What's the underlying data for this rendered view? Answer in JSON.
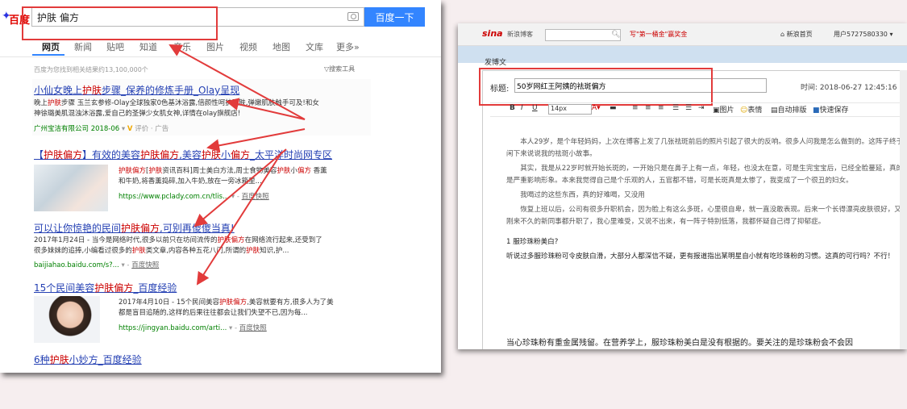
{
  "baidu": {
    "logo_text": "百度",
    "search_value": "护肤 偏方",
    "search_button": "百度一下",
    "tabs": [
      "网页",
      "新闻",
      "贴吧",
      "知道",
      "音乐",
      "图片",
      "视频",
      "地图",
      "文库",
      "更多»"
    ],
    "result_count": "百度为您找到相关结果约13,100,000个",
    "search_tools": "搜索工具",
    "results": [
      {
        "title": "小仙女晚上护肤步骤_保养的修炼手册_Olay呈现",
        "desc_line1": "晚上护肤步骤 玉兰玄参修-Olay全球独家0色基沐浴露,倍颜性呵护肌肤,弹嫩肌肤触手可及!和女",
        "desc_line2": "神徐璐美肌混浊沐浴露,爱自己的圣弹少女肌女神,详情在olay旗舰店!",
        "url": "广州宝洁有限公司  2018-06",
        "extra": "评价 · 广告"
      },
      {
        "title": "【护肤偏方】有效的美容护肤偏方,美容护肤小偏方_太平洋时尚网专区",
        "desc_line1": "护肤偏方[护肤资讯百科]周士美白方法,周士食物美容护肤小偏方 香薰",
        "desc_line2": "和牛奶,将香薰捣碎,加入牛奶,放在一旁冰箱里...",
        "url": "https://www.pclady.com.cn/tlis...",
        "extra": "百度快照"
      },
      {
        "title": "可以让你惊艳的民间护肤偏方,可别再傻傻当真!",
        "desc_line1": "2017年1月24日 - 当今是网络时代,很多以前只在坊间流传的护肤偏方在网络流行起来,还受到了",
        "desc_line2": "很多妹妹的追捧,小编看过很多的护肤类文章,内容各种五花八门,所谓的护肤知识,护...",
        "url": "baijiahao.baidu.com/s?...",
        "extra": "百度快照"
      },
      {
        "title": "15个民间美容护肤偏方_百度经验",
        "desc_line1": "2017年4月10日 - 15个民间美容护肤偏方,美容就要有方,很多人为了美",
        "desc_line2": "都是盲目追随的,这样的后果往往都会让我们失望不已,因为每...",
        "url": "https://jingyan.baidu.com/arti...",
        "extra": "百度快照"
      },
      {
        "title": "6种护肤小妙方_百度经验"
      }
    ]
  },
  "sina": {
    "logo": "sina",
    "logo_sub": "新浪博客",
    "promo": "写\"第一桶金\"赢奖金",
    "home_link": "新浪首页",
    "user_link": "用户5727580330 ▾",
    "compose_label": "发博文",
    "title_label": "标题:",
    "title_value": "50岁网红王阿姨的祛斑偏方",
    "time_label": "时间: 2018-06-27 12:45:16",
    "toolbar": {
      "bold": "B",
      "italic": "I",
      "underline": "U",
      "font_size": "14px",
      "image": "图片",
      "emoji": "表情",
      "auto_layout": "自动排版",
      "quick_save": "快速保存"
    },
    "paragraphs": [
      "本人29岁，是个年轻妈妈，上次在博客上发了几张祛斑前后的照片引起了很大的反响。很多人问我是怎么做到的。这阵子终于闲下来说说我的祛斑小故事。",
      "其实，我是从22岁时就开始长斑的，一开始只是在鼻子上有一点，年轻，也没太在意，可是生完宝宝后，已经全脸蔓延，真的是严重影响形象。本来我觉得自己是个乐观的人，五官都不错，可是长斑真是太惨了，我变成了一个很丑的妇女。",
      "我喝过的这些东西，真的好难喝，又没用",
      "恢复上班以后，公司有很多升职机会，因为脸上有这么多斑，心里很自卑，就一直没敢表现。后来一个长得漂亮皮肤很好，又刚来不久的新同事都升职了，我心里难受，又说不出来，有一阵子特别低落，我都怀疑自己得了抑郁症。"
    ],
    "question": "1 服珍珠粉美白?",
    "answer": "听说过多服珍珠粉可令皮肤白滑，大部分人都深信不疑，更有报道指出某明星自小就有吃珍珠粉的习惯。这真的可行吗？不行！",
    "footer": "当心珍珠粉有重金属残留。在营养学上，服珍珠粉美白是没有根据的。要关注的是珍珠粉会不会因"
  },
  "colors": {
    "baidu_blue": "#3385ff",
    "link_blue": "#2440b3",
    "highlight_red": "#c00000",
    "annotation_red": "#e23b3b",
    "url_green": "#008000"
  }
}
